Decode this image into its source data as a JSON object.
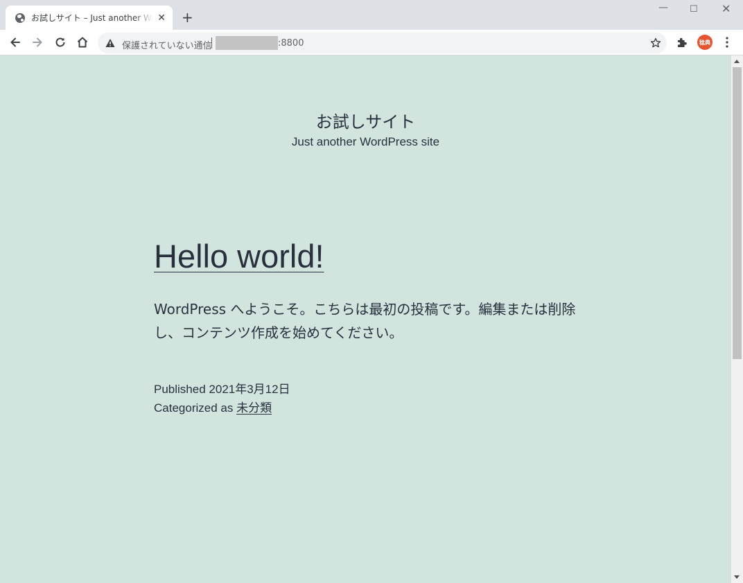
{
  "browser": {
    "tab_title": "お試しサイト – Just another WordPress site",
    "tab_close": "✕",
    "new_tab": "+",
    "window_controls": {
      "minimize": "—",
      "maximize": "☐",
      "close": "✕"
    },
    "security_label": "保護されていない通信",
    "url_port": ":8800",
    "profile_initials": "稔典",
    "icons": [
      "back-icon",
      "forward-icon",
      "reload-icon",
      "home-icon",
      "warning-icon",
      "star-icon",
      "extensions-icon",
      "menu-icon"
    ]
  },
  "site": {
    "title": "お試しサイト",
    "description": "Just another WordPress site"
  },
  "post": {
    "title": "Hello world!",
    "content": "WordPress へようこそ。こちらは最初の投稿です。編集または削除し、コンテンツ作成を始めてください。",
    "published_label": "Published",
    "published_date": "2021年3月12日",
    "category_label": "Categorized as",
    "category": "未分類"
  },
  "colors": {
    "page_background": "#d1e4dd",
    "text": "#28303d",
    "tabbar": "#dee1e6",
    "avatar": "#e8542f"
  }
}
